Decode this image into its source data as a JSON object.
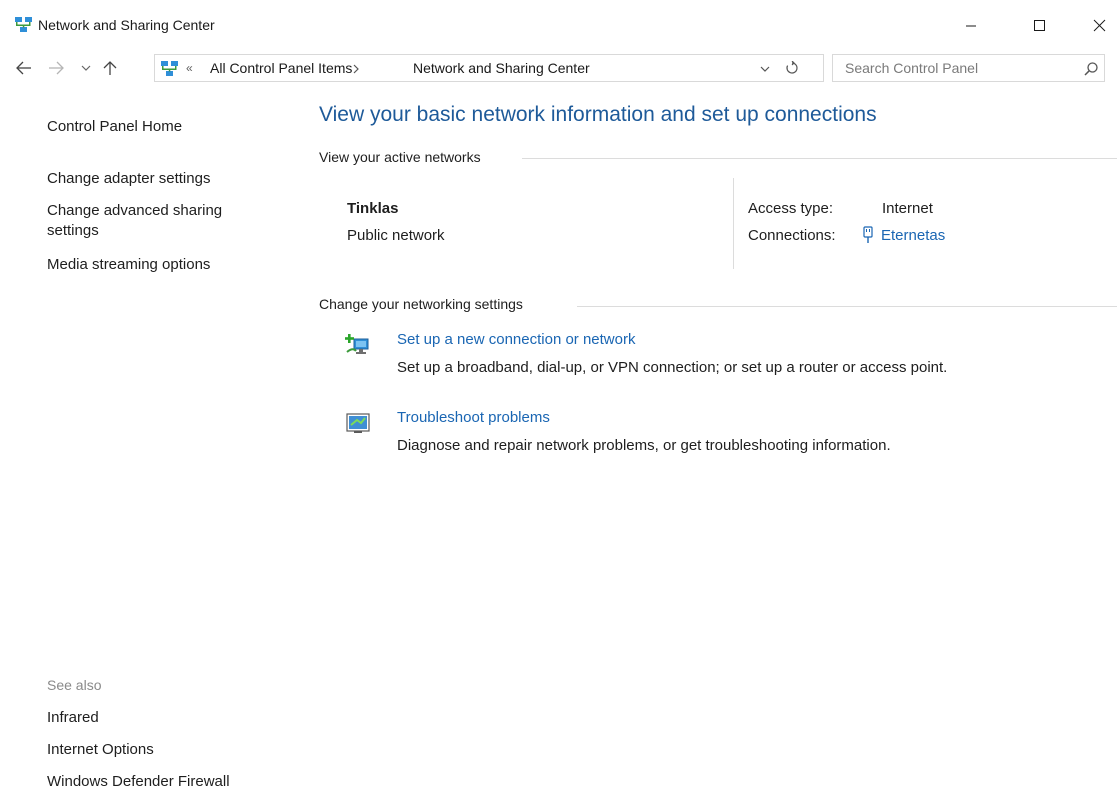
{
  "window": {
    "title": "Network and Sharing Center",
    "icons": {
      "app": "network-center-icon",
      "minimize": "minimize-icon",
      "maximize": "maximize-icon",
      "close": "close-icon"
    }
  },
  "navigation": {
    "icons": {
      "back": "back-arrow-icon",
      "forward": "forward-arrow-icon",
      "recent": "recent-locations-icon",
      "up": "up-arrow-icon"
    },
    "address": {
      "overflow_chevron": "«",
      "breadcrumbs": [
        "All Control Panel Items",
        "Network and Sharing Center"
      ],
      "icons": {
        "dropdown": "chevron-down-icon",
        "refresh": "refresh-icon"
      }
    },
    "search": {
      "placeholder": "Search Control Panel",
      "value": "",
      "icon": "search-icon"
    }
  },
  "sidebar": {
    "links": [
      "Control Panel Home",
      "Change adapter settings",
      "Change advanced sharing settings",
      "Media streaming options"
    ],
    "see_also": {
      "heading": "See also",
      "links": [
        "Infrared",
        "Internet Options",
        "Windows Defender Firewall"
      ]
    }
  },
  "main": {
    "title": "View your basic network information and set up connections",
    "active_networks": {
      "heading": "View your active networks",
      "network": {
        "name": "Tinklas",
        "category": "Public network",
        "access_type_label": "Access type:",
        "access_type_value": "Internet",
        "connections_label": "Connections:",
        "connection_name": "Eternetas",
        "connection_icon": "ethernet-icon"
      }
    },
    "settings": {
      "heading": "Change your networking settings",
      "tasks": [
        {
          "title": "Set up a new connection or network",
          "description": "Set up a broadband, dial-up, or VPN connection; or set up a router or access point.",
          "icon": "new-connection-icon"
        },
        {
          "title": "Troubleshoot problems",
          "description": "Diagnose and repair network problems, or get troubleshooting information.",
          "icon": "troubleshoot-icon"
        }
      ]
    }
  },
  "colors": {
    "link": "#1a66b3",
    "title": "#1e5a99",
    "text": "#1e1e1e",
    "muted": "#8a8a8a",
    "divider": "#dcdcdc",
    "border": "#d9d9d9"
  }
}
